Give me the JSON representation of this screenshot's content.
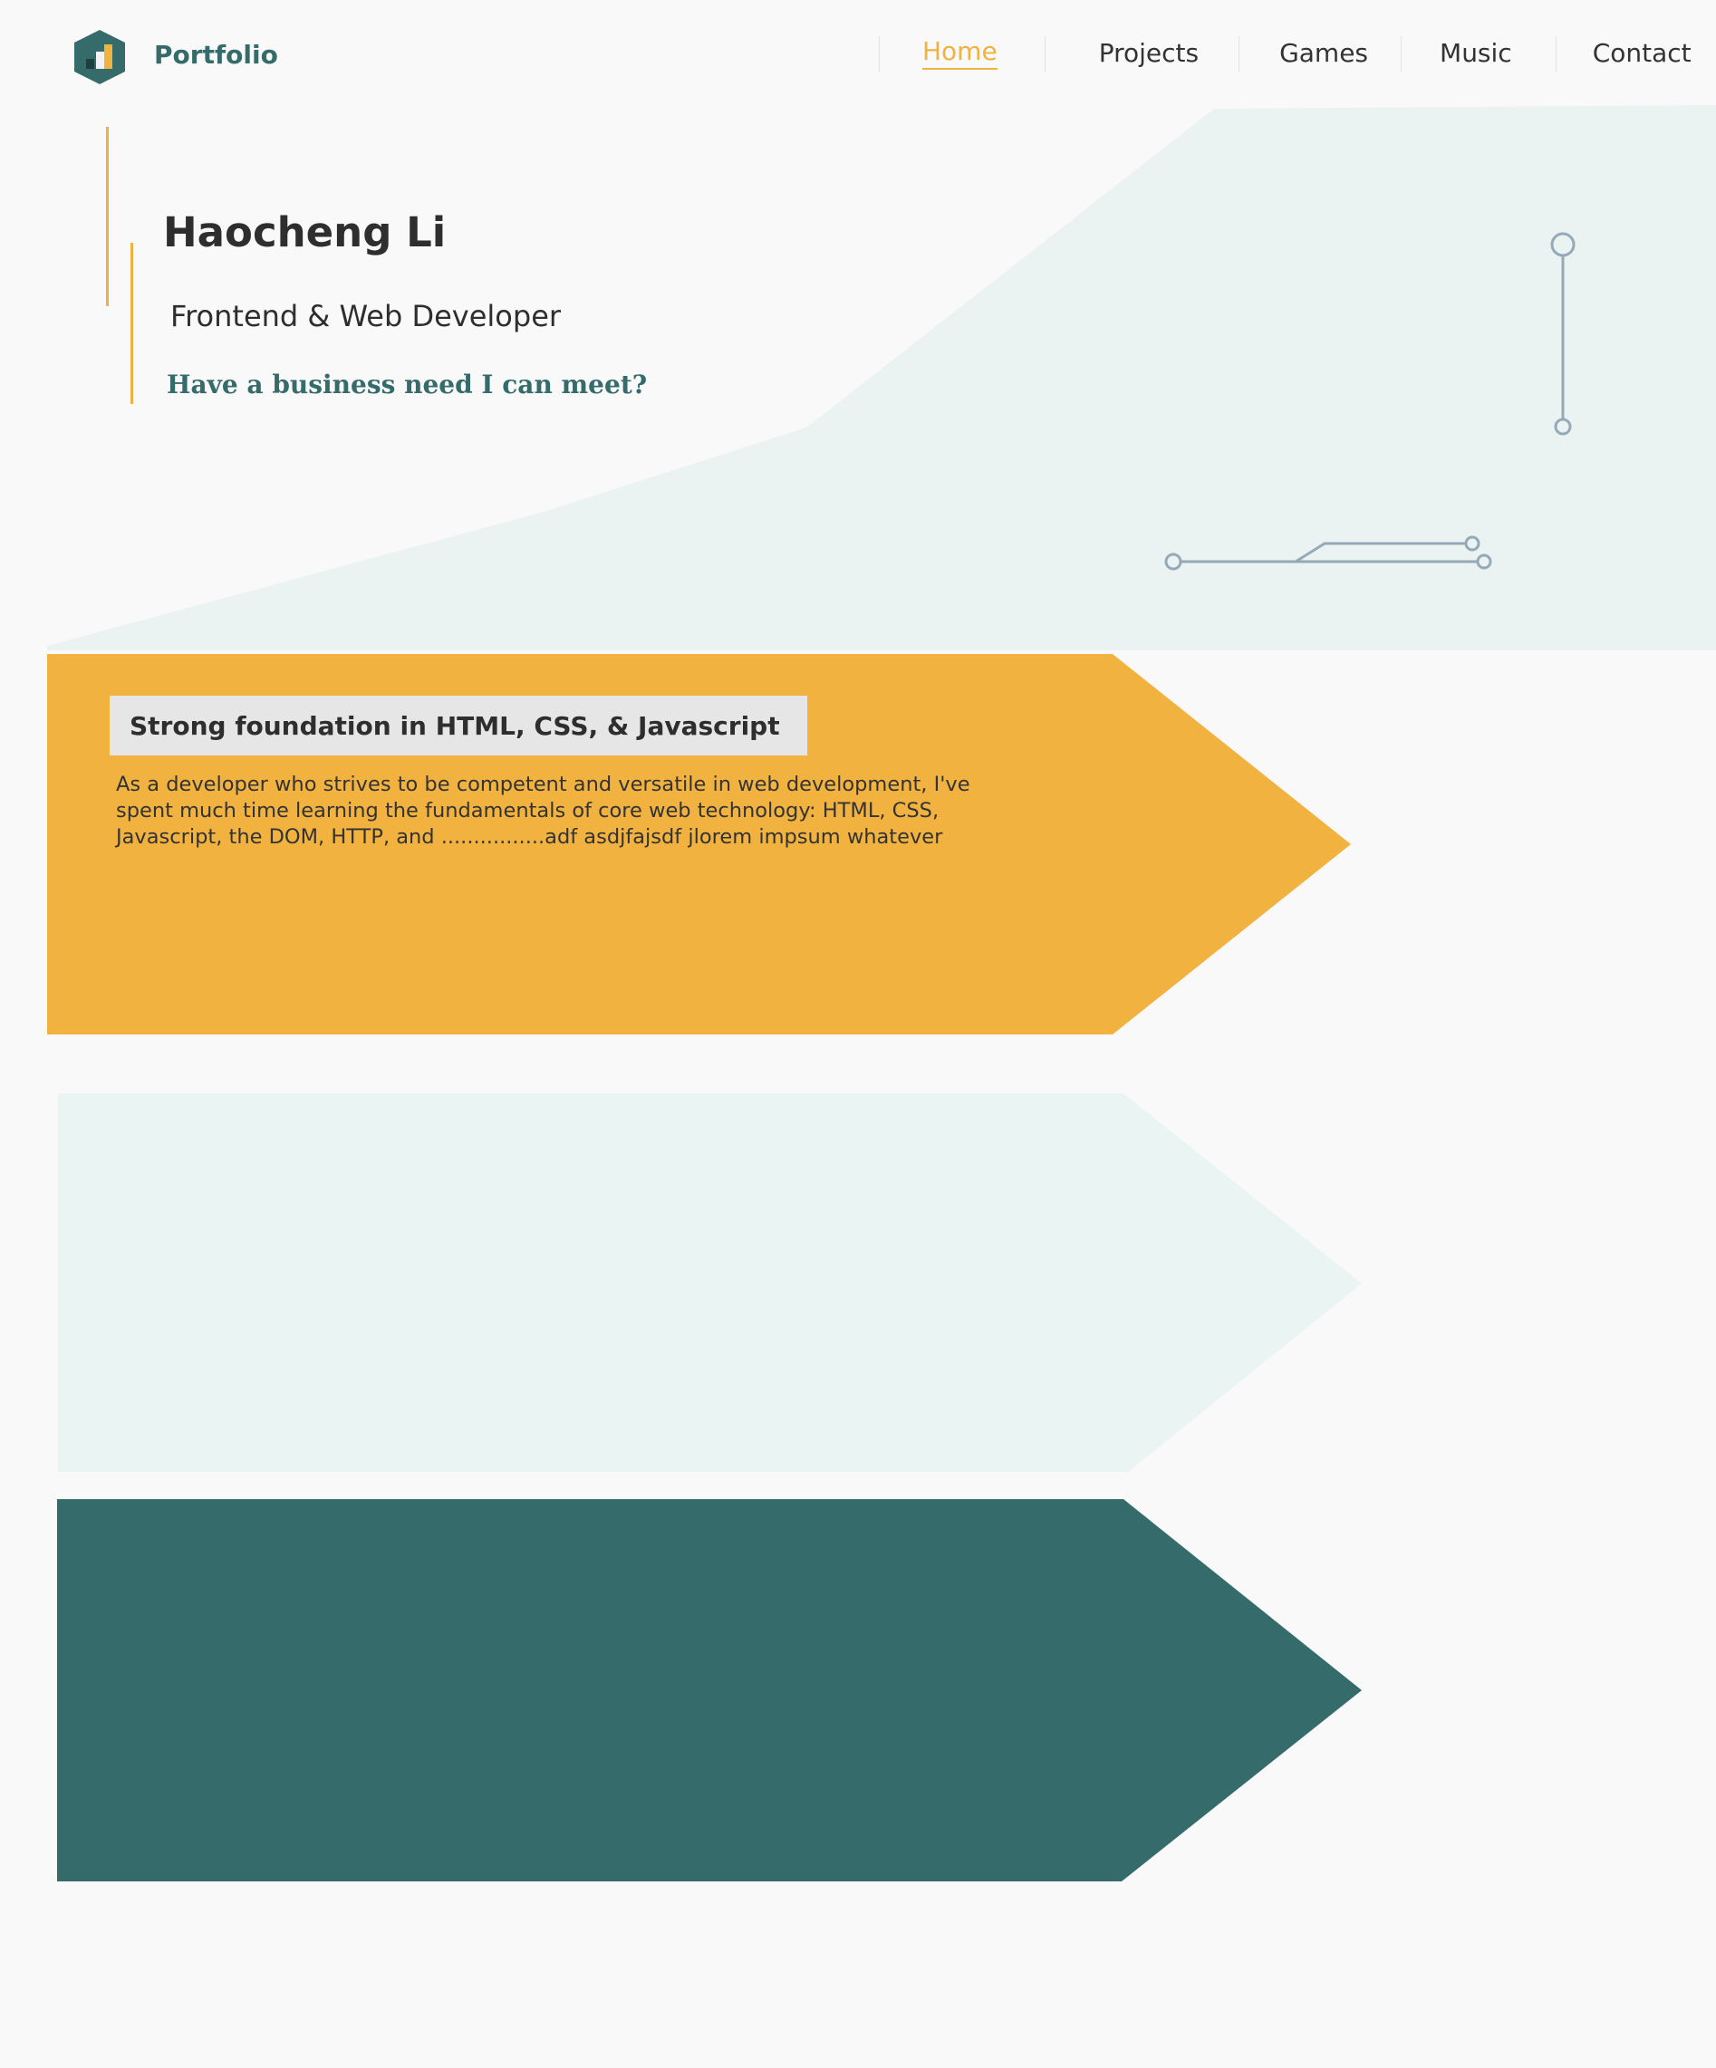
{
  "brand": {
    "name": "Portfolio",
    "logo_icon": "hexagon-bar-chart-icon"
  },
  "nav": {
    "items": [
      {
        "label": "Home",
        "active": true
      },
      {
        "label": "Projects",
        "active": false
      },
      {
        "label": "Games",
        "active": false
      },
      {
        "label": "Music",
        "active": false
      },
      {
        "label": "Contact",
        "active": false
      }
    ]
  },
  "hero": {
    "name": "Haocheng Li",
    "role": "Frontend & Web Developer",
    "cta": "Have a business need I can meet?"
  },
  "cards": [
    {
      "title": "Strong foundation in HTML, CSS, & Javascript",
      "body": "As a developer who strives to be competent and versatile in web development, I've spent much time learning the fundamentals of core web technology: HTML, CSS, Javascript, the DOM, HTTP, and ................adf asdjfajsdf jlorem impsum whatever",
      "color": "#f2b240"
    },
    {
      "color": "#eaf4f2"
    },
    {
      "color": "#356b6b"
    }
  ],
  "colors": {
    "accent": "#f0b240",
    "brand": "#356b6b",
    "hero_bg": "#eaf3f1",
    "circuit": "#95aab8"
  }
}
